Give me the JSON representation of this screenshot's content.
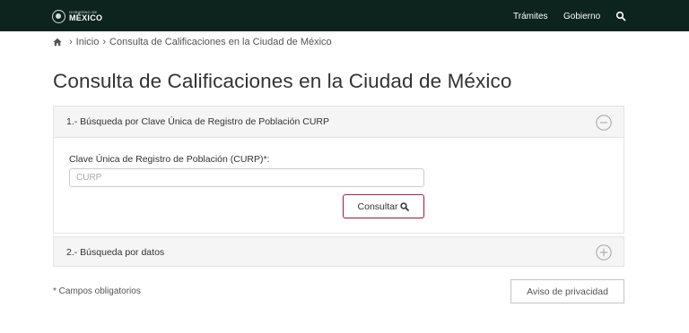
{
  "header": {
    "logo_small": "Gobierno de",
    "logo_big": "MÉXICO",
    "nav": [
      {
        "label": "Trámites"
      },
      {
        "label": "Gobierno"
      }
    ],
    "search_icon": "search-icon",
    "background": "#0c231e"
  },
  "breadcrumb": {
    "home_icon": "home-icon",
    "items": [
      "Inicio",
      "Consulta de Calificaciones en la Ciudad de México"
    ]
  },
  "page": {
    "title": "Consulta de Calificaciones en la Ciudad de México"
  },
  "panel_curp": {
    "title": "1.- Búsqueda por Clave Única de Registro de Población CURP",
    "state": "expanded",
    "toggle_icon": "minus-circle-icon",
    "field_label": "Clave Única de Registro de Población (CURP)*:",
    "input_value": "",
    "input_placeholder": "CURP",
    "button_label": "Consultar",
    "button_icon": "search-icon"
  },
  "panel_datos": {
    "title": "2.- Búsqueda por datos",
    "state": "collapsed",
    "toggle_icon": "plus-circle-icon"
  },
  "footer": {
    "required_note": "* Campos obligatorios",
    "privacy_button": "Aviso de privacidad"
  },
  "colors": {
    "accent": "#9d2449",
    "panel_header_bg": "#f5f5f5",
    "text": "#333333"
  }
}
